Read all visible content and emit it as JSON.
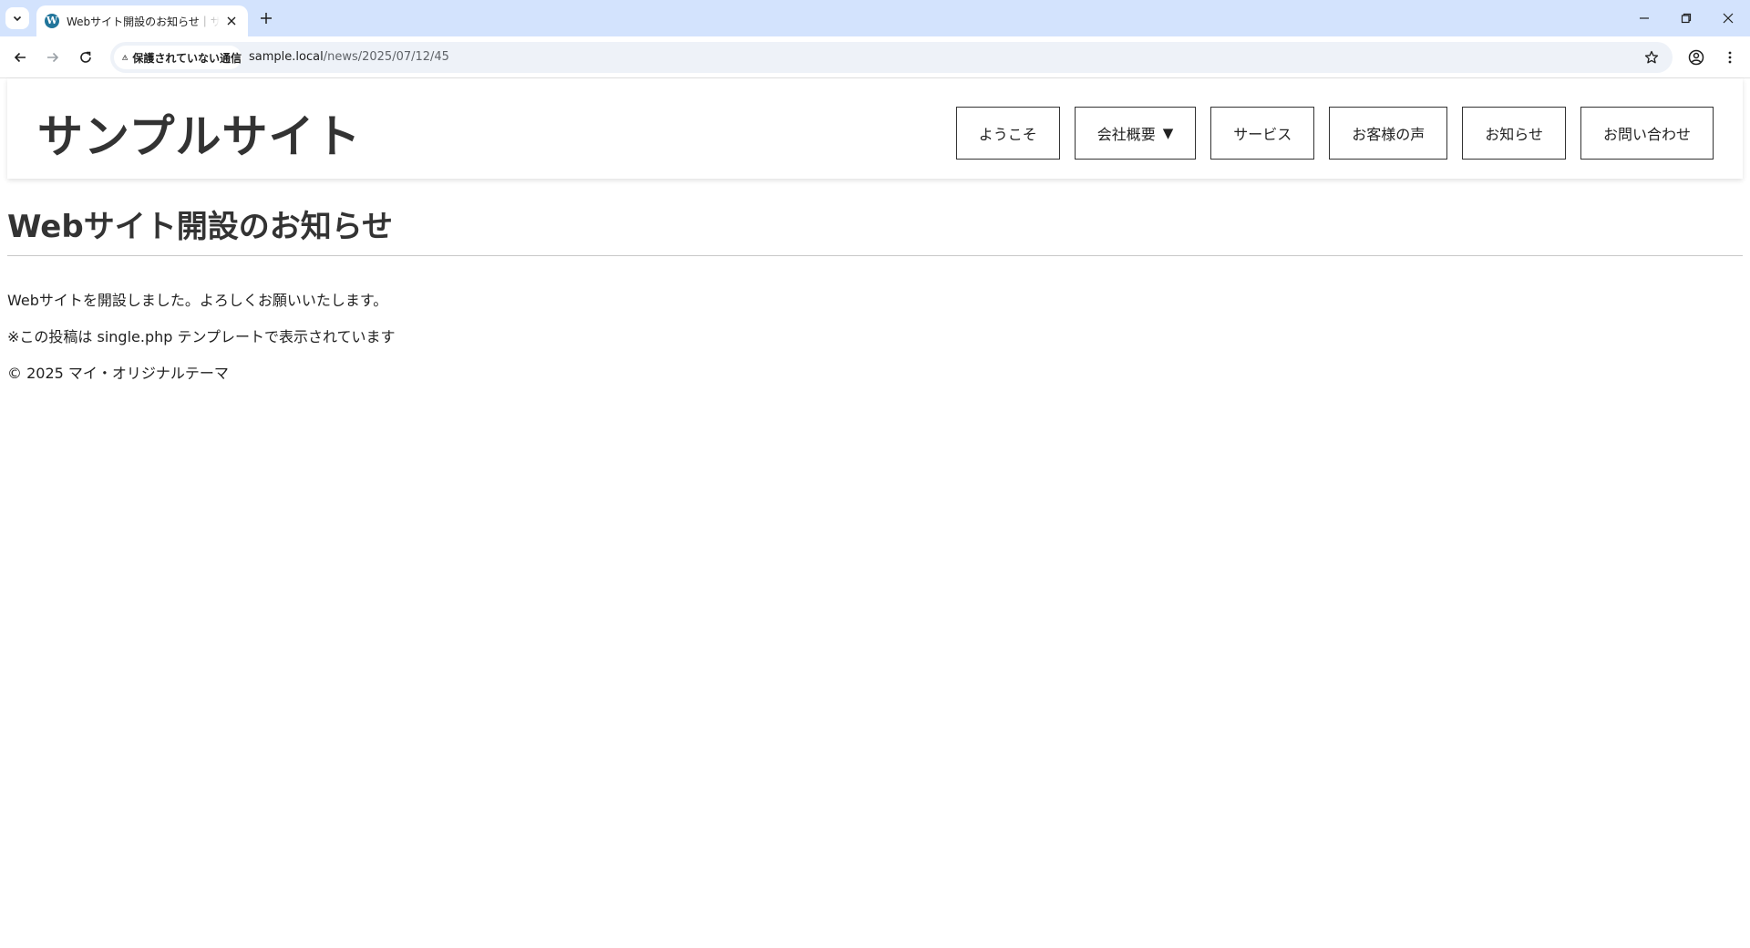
{
  "browser": {
    "tab_title": "Webサイト開設のお知らせ｜サンプルサイト",
    "address_security": "保護されていない通信",
    "url_host": "sample.local",
    "url_path": "/news/2025/07/12/45"
  },
  "site": {
    "title": "サンプルサイト",
    "nav": [
      {
        "label": "ようこそ"
      },
      {
        "label": "会社概要",
        "arrow": "▼"
      },
      {
        "label": "サービス"
      },
      {
        "label": "お客様の声"
      },
      {
        "label": "お知らせ"
      },
      {
        "label": "お問い合わせ"
      }
    ]
  },
  "post": {
    "title": "Webサイト開設のお知らせ",
    "paragraph": "Webサイトを開設しました。よろしくお願いいたします。",
    "note": "※この投稿は single.php テンプレートで表示されています"
  },
  "footer": {
    "copyright": "© 2025 マイ・オリジナルテーマ"
  }
}
